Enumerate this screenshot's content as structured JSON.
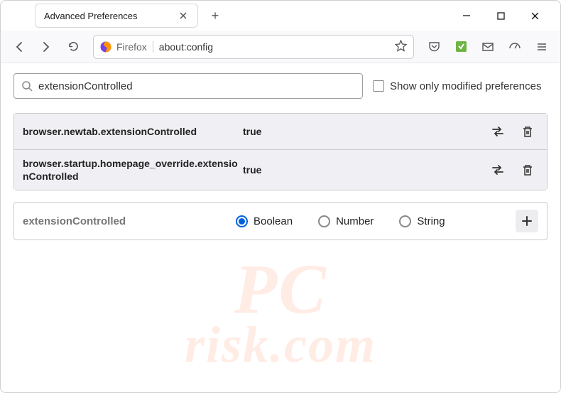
{
  "window": {
    "tab_title": "Advanced Preferences",
    "new_tab": "+"
  },
  "toolbar": {
    "firefox_label": "Firefox",
    "url": "about:config"
  },
  "search": {
    "value": "extensionControlled",
    "checkbox_label": "Show only modified preferences"
  },
  "prefs": [
    {
      "name": "browser.newtab.extensionControlled",
      "value": "true"
    },
    {
      "name": "browser.startup.homepage_override.extensionControlled",
      "value": "true"
    }
  ],
  "addRow": {
    "name": "extensionControlled",
    "types": [
      "Boolean",
      "Number",
      "String"
    ],
    "selected": 0
  },
  "watermark": {
    "line1": "PC",
    "line2": "risk.com"
  }
}
